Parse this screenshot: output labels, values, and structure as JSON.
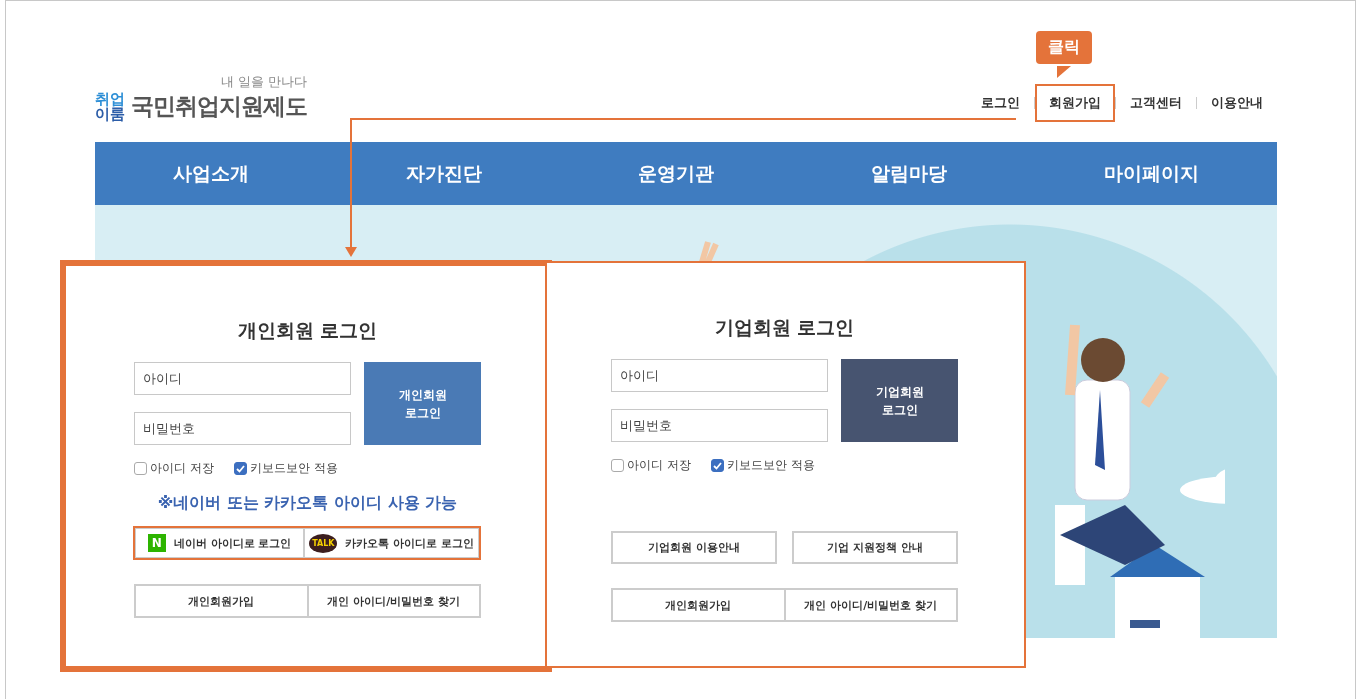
{
  "logo": {
    "mark_top": "취업",
    "mark_bottom": "이룸",
    "tagline": "내 일을 만나다",
    "title": "국민취업지원제도"
  },
  "callout": {
    "text": "클릭"
  },
  "top_links": [
    {
      "label": "로그인",
      "highlighted": false
    },
    {
      "label": "회원가입",
      "highlighted": true
    },
    {
      "label": "고객센터",
      "highlighted": false
    },
    {
      "label": "이용안내",
      "highlighted": false
    }
  ],
  "nav": [
    "사업소개",
    "자가진단",
    "운영기관",
    "알림마당",
    "마이페이지"
  ],
  "panels": [
    {
      "kind": "personal",
      "emphasized": true,
      "title": "개인회원 로그인",
      "id_placeholder": "아이디",
      "pw_placeholder": "비밀번호",
      "login_button": "개인회원 로그인",
      "options": [
        {
          "label": "아이디 저장",
          "checked": false
        },
        {
          "label": "키보드보안 적용",
          "checked": true
        }
      ],
      "notice": "※네이버 또는 카카오톡 아이디 사용 가능",
      "social_highlighted": true,
      "social": [
        {
          "kind": "naver",
          "icon_text": "N",
          "label": "네이버 아이디로 로그인"
        },
        {
          "kind": "kakao",
          "icon_text": "TALK",
          "label": "카카오톡 아이디로 로그인"
        }
      ],
      "links": [
        "개인회원가입",
        "개인 아이디/비밀번호 찾기"
      ]
    },
    {
      "kind": "corporate",
      "emphasized": false,
      "title": "기업회원 로그인",
      "id_placeholder": "아이디",
      "pw_placeholder": "비밀번호",
      "login_button": "기업회원 로그인",
      "options": [
        {
          "label": "아이디 저장",
          "checked": false
        },
        {
          "label": "키보드보안 적용",
          "checked": true
        }
      ],
      "info_links": [
        "기업회원 이용안내",
        "기업 지원정책 안내"
      ],
      "links": [
        "개인회원가입",
        "개인 아이디/비밀번호 찾기"
      ]
    }
  ]
}
